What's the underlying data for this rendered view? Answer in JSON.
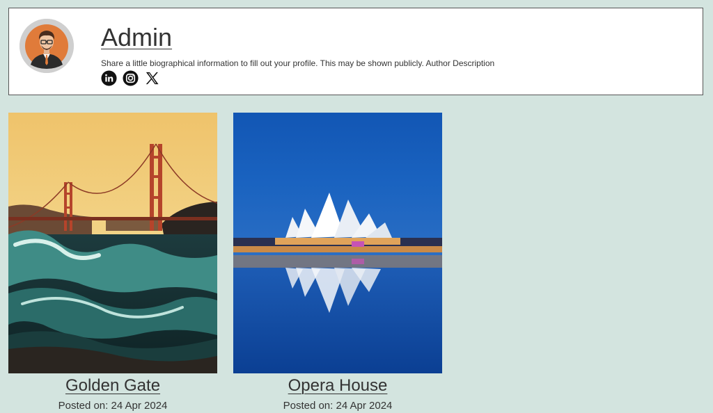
{
  "author": {
    "name": "Admin",
    "description": "Share a little biographical information to fill out your profile. This may be shown publicly. Author Description",
    "social": [
      {
        "icon": "linkedin-icon"
      },
      {
        "icon": "instagram-icon"
      },
      {
        "icon": "x-twitter-icon"
      }
    ]
  },
  "posts": [
    {
      "title": "Golden Gate",
      "date_label": "Posted on: 24 Apr 2024",
      "image": "golden-gate-bridge-photo"
    },
    {
      "title": "Opera House",
      "date_label": "Posted on: 24 Apr 2024",
      "image": "sydney-opera-house-photo"
    }
  ],
  "colors": {
    "page_background": "#d3e4df",
    "card_background": "#ffffff",
    "text": "#333333"
  }
}
